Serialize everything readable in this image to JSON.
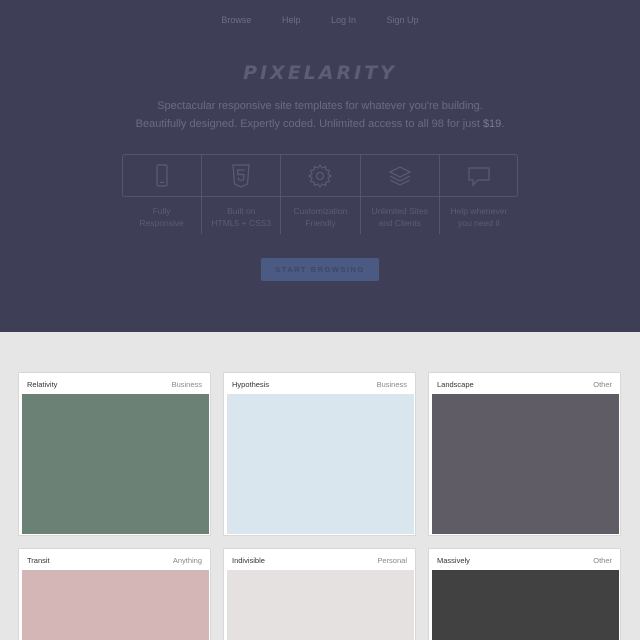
{
  "nav": {
    "items": [
      "Browse",
      "Help",
      "Log In",
      "Sign Up"
    ]
  },
  "logo": "PIXELARITY",
  "tagline": {
    "line1": "Spectacular responsive site templates for whatever you're building.",
    "line2_pre": "Beautifully designed. Expertly coded. Unlimited access to all 98 for just ",
    "line2_price": "$19",
    "line2_post": "."
  },
  "features": [
    {
      "icon": "mobile-phone-icon",
      "line1": "Fully",
      "line2": "Responsive"
    },
    {
      "icon": "html5-icon",
      "line1": "Built on",
      "line2": "HTML5 + CSS3"
    },
    {
      "icon": "gear-icon",
      "line1": "Customization",
      "line2": "Friendly"
    },
    {
      "icon": "layers-icon",
      "line1": "Unlimited Sites",
      "line2": "and Clients"
    },
    {
      "icon": "speech-bubble-icon",
      "line1": "Help whenever",
      "line2": "you need it"
    }
  ],
  "cta_label": "START BROWSING",
  "colors": {
    "hero_bg": "#3e3e57",
    "page_bg": "#e6e6e6",
    "cta_bg": "#4a5a82"
  },
  "templates": [
    {
      "name": "Relativity",
      "category": "Business",
      "color": "#6b8176"
    },
    {
      "name": "Hypothesis",
      "category": "Business",
      "color": "#d9e6ee"
    },
    {
      "name": "Landscape",
      "category": "Other",
      "color": "#5f5c66"
    },
    {
      "name": "Transit",
      "category": "Anything",
      "color": "#d4b6b6"
    },
    {
      "name": "Indivisible",
      "category": "Personal",
      "color": "#e6e1e1"
    },
    {
      "name": "Massively",
      "category": "Other",
      "color": "#414141"
    }
  ]
}
